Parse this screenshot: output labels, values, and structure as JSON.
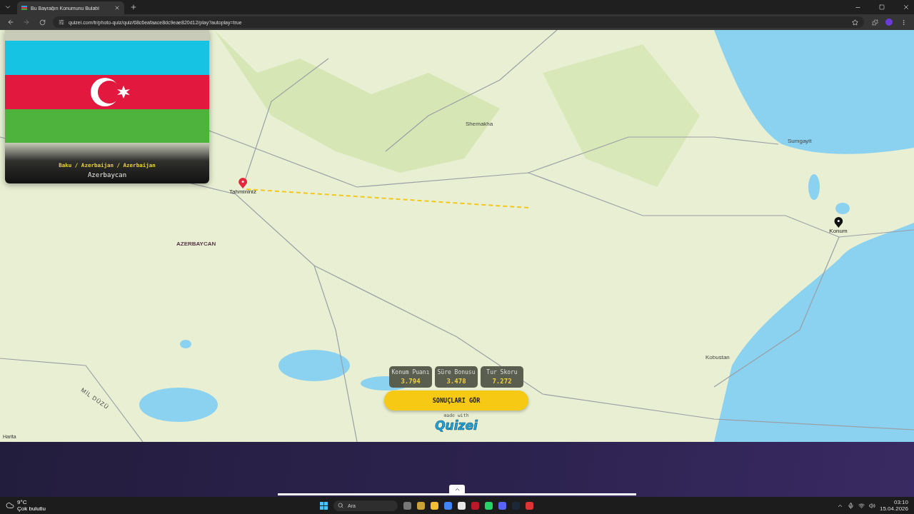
{
  "browser": {
    "tab_title": "Bu Bayrağın Konumunu Bulabi",
    "url": "quizei.com/tr/photo-quiz/quiz/68c6eafaace8dc9eae820d12/play?autoplay=true"
  },
  "flag_card": {
    "route": "Baku / Azerbaijan / Azerbaijan",
    "country": "Azerbaycan"
  },
  "map": {
    "labels": [
      {
        "text": "Shemakha",
        "kind": "town"
      },
      {
        "text": "Sumgayit",
        "kind": "town"
      },
      {
        "text": "AZERBAYCAN",
        "kind": "country"
      },
      {
        "text": "Kobustan",
        "kind": "town"
      },
      {
        "text": "MİL DÜZÜ",
        "kind": "region"
      }
    ],
    "markers": [
      {
        "label": "Tahmininiz",
        "kind": "guess"
      },
      {
        "label": "Konum",
        "kind": "answer"
      }
    ],
    "attribution": "Harita"
  },
  "scores": [
    {
      "label": "Konum Puanı",
      "value": "3.794"
    },
    {
      "label": "Süre Bonusu",
      "value": "3.478"
    },
    {
      "label": "Tur Skoru",
      "value": "7.272"
    }
  ],
  "results_button": "SONUÇLARI GÖR",
  "made_with": "made with",
  "logo": "Quizei",
  "taskbar": {
    "temperature": "9°C",
    "weather": "Çok bulutlu",
    "search_placeholder": "Ara",
    "time": "03:10",
    "date": "15.04.2026"
  }
}
